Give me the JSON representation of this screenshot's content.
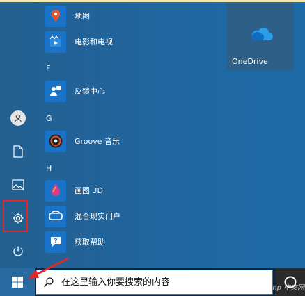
{
  "apps": [
    {
      "label": "地图",
      "icon": "map-pin-icon",
      "color": "#1a73c7"
    },
    {
      "label": "电影和电视",
      "icon": "film-play-icon",
      "color": "#1a73c7"
    },
    {
      "label": "反馈中心",
      "icon": "feedback-person-icon",
      "color": "#1a73c7"
    },
    {
      "label": "Groove 音乐",
      "icon": "groove-disc-icon",
      "color": "#1a73c7"
    },
    {
      "label": "画图 3D",
      "icon": "paint-drop-icon",
      "color": "#1a73c7"
    },
    {
      "label": "混合现实门户",
      "icon": "headset-icon",
      "color": "#1a73c7"
    },
    {
      "label": "获取帮助",
      "icon": "help-chat-icon",
      "color": "#1a73c7"
    }
  ],
  "headers": {
    "f": "F",
    "g": "G",
    "h": "H"
  },
  "tile": {
    "label": "OneDrive",
    "icon": "cloud-icon"
  },
  "left_rail": {
    "items": [
      "user-avatar-icon",
      "document-icon",
      "pictures-icon",
      "settings-gear-icon",
      "power-icon"
    ]
  },
  "search": {
    "placeholder": "在这里输入你要搜索的内容"
  },
  "watermark": "php 中文网",
  "colors": {
    "highlight": "#e0282c",
    "accent": "#1a73c7"
  }
}
